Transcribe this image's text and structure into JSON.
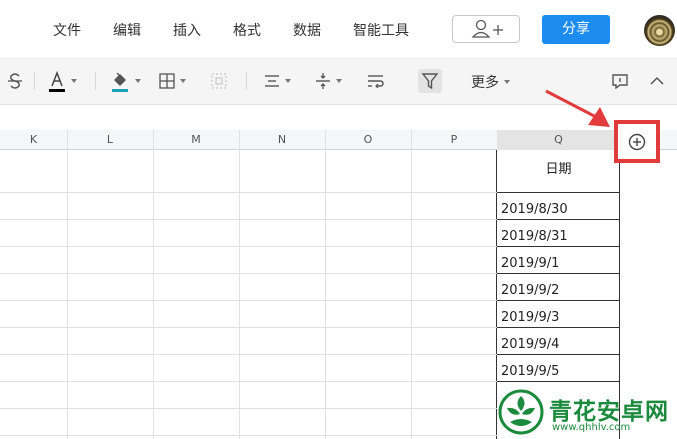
{
  "menu": {
    "items": [
      "文件",
      "编辑",
      "插入",
      "格式",
      "数据",
      "智能工具"
    ]
  },
  "share": {
    "label": "分享"
  },
  "toolbar": {
    "more_label": "更多"
  },
  "columns": [
    "K",
    "L",
    "M",
    "N",
    "O",
    "P",
    "Q"
  ],
  "cells": {
    "header": "日期",
    "dates": [
      "2019/8/30",
      "2019/8/31",
      "2019/9/1",
      "2019/9/2",
      "2019/9/3",
      "2019/9/4",
      "2019/9/5"
    ]
  },
  "watermark": {
    "name": "青花安卓网",
    "url": "www.qhhlv.com"
  },
  "colors": {
    "accent": "#1d8cf0",
    "annotation": "#e23b3b",
    "watermark": "#1b8a3c",
    "font_underline": "#000000",
    "fill_underline": "#1aa3b8"
  },
  "icons": [
    "strikethrough-icon",
    "font-color-icon",
    "fill-color-icon",
    "border-icon",
    "merge-cells-icon",
    "align-icon",
    "vertical-align-icon",
    "wrap-text-icon",
    "filter-icon",
    "comment-icon",
    "collapse-icon",
    "add-user-icon",
    "add-column-icon"
  ]
}
